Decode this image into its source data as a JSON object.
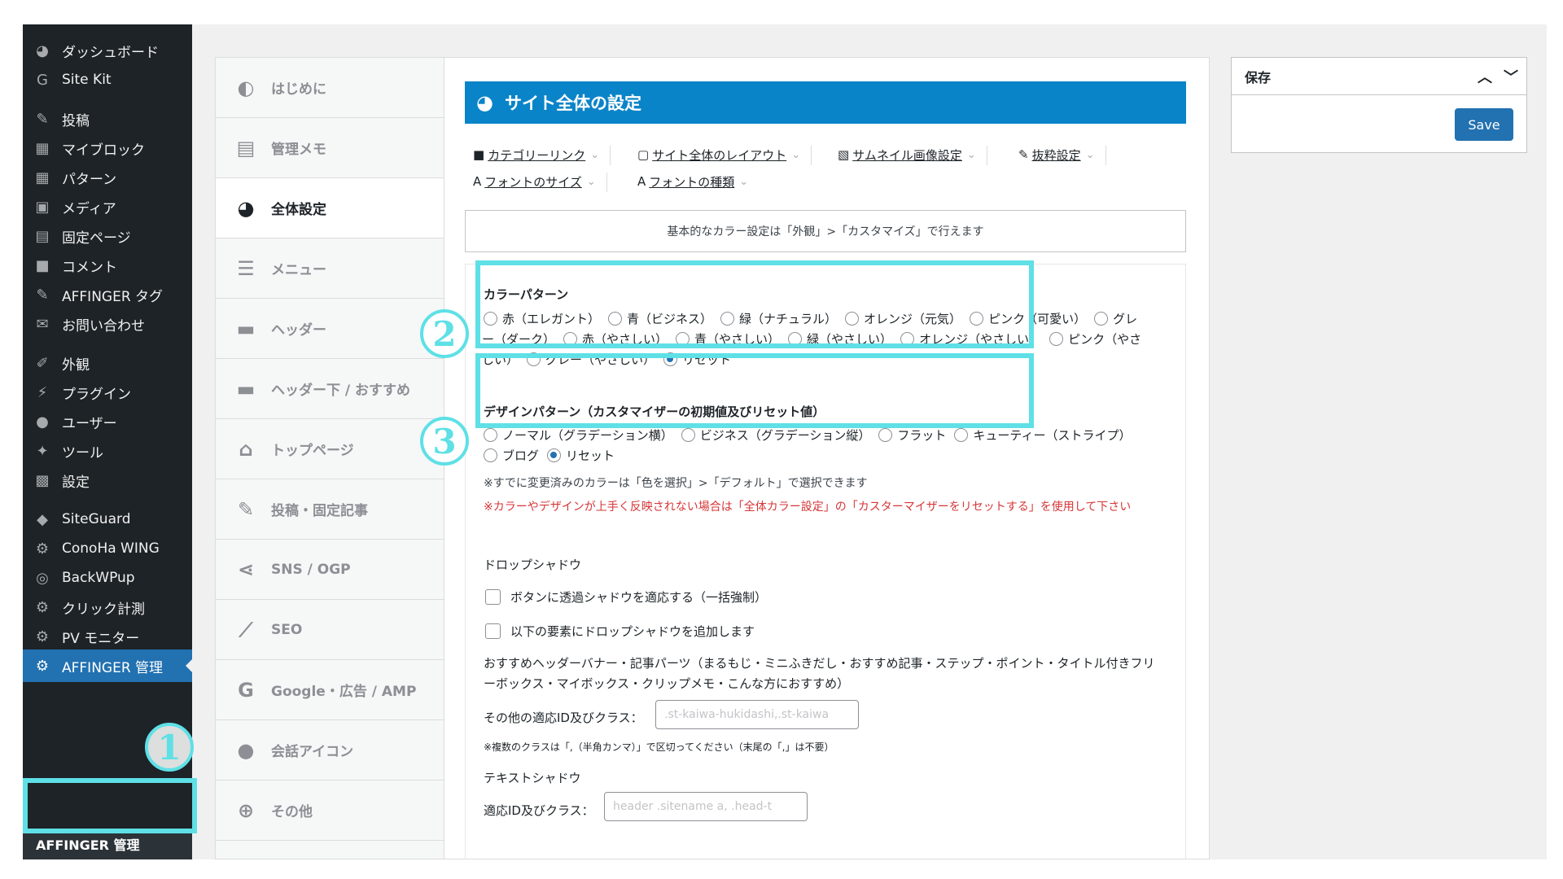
{
  "wp_menu": [
    {
      "label": "ダッシュボード",
      "icon": "dashboard-icon",
      "glyph": "◕"
    },
    {
      "label": "Site Kit",
      "icon": "google-g-icon",
      "glyph": "G"
    },
    {
      "label": "投稿",
      "icon": "pushpin-icon",
      "glyph": "✎"
    },
    {
      "label": "マイブロック",
      "icon": "blocks-grid-icon",
      "glyph": "▦"
    },
    {
      "label": "パターン",
      "icon": "pattern-grid-icon",
      "glyph": "▦"
    },
    {
      "label": "メディア",
      "icon": "media-icon",
      "glyph": "▣"
    },
    {
      "label": "固定ページ",
      "icon": "pages-icon",
      "glyph": "▤"
    },
    {
      "label": "コメント",
      "icon": "comment-icon",
      "glyph": "■"
    },
    {
      "label": "AFFINGER タグ",
      "icon": "pushpin-icon",
      "glyph": "✎"
    },
    {
      "label": "お問い合わせ",
      "icon": "mail-icon",
      "glyph": "✉"
    },
    {
      "label": "外観",
      "icon": "appearance-brush-icon",
      "glyph": "✐"
    },
    {
      "label": "プラグイン",
      "icon": "plugin-icon",
      "glyph": "⚡"
    },
    {
      "label": "ユーザー",
      "icon": "user-icon",
      "glyph": "●"
    },
    {
      "label": "ツール",
      "icon": "wrench-icon",
      "glyph": "✦"
    },
    {
      "label": "設定",
      "icon": "settings-icon",
      "glyph": "▩"
    },
    {
      "label": "SiteGuard",
      "icon": "siteguard-icon",
      "glyph": "◆"
    },
    {
      "label": "ConoHa WING",
      "icon": "gear-icon",
      "glyph": "⚙"
    },
    {
      "label": "BackWPup",
      "icon": "backwpup-icon",
      "glyph": "◎"
    },
    {
      "label": "クリック計測",
      "icon": "gear-icon",
      "glyph": "⚙"
    },
    {
      "label": "PV モニター",
      "icon": "gear-icon",
      "glyph": "⚙"
    },
    {
      "label": "AFFINGER 管理",
      "icon": "gear-icon",
      "glyph": "⚙"
    }
  ],
  "wp_submenu_label": "AFFINGER 管理",
  "badges": {
    "one": "1",
    "two": "2",
    "three": "3"
  },
  "highlight_color": "#5ee0e6",
  "aff_nav": [
    {
      "label": "はじめに",
      "icon": "beginner-leaf-icon",
      "glyph": "◐"
    },
    {
      "label": "管理メモ",
      "icon": "memo-document-icon",
      "glyph": "▤"
    },
    {
      "label": "全体設定",
      "icon": "palette-icon",
      "glyph": "◕"
    },
    {
      "label": "メニュー",
      "icon": "menu-bars-icon",
      "glyph": "☰"
    },
    {
      "label": "ヘッダー",
      "icon": "header-layout-icon",
      "glyph": "▬"
    },
    {
      "label": "ヘッダー下 / おすすめ",
      "icon": "header-below-icon",
      "glyph": "▬"
    },
    {
      "label": "トップページ",
      "icon": "home-icon",
      "glyph": "⌂"
    },
    {
      "label": "投稿・固定記事",
      "icon": "edit-post-icon",
      "glyph": "✎"
    },
    {
      "label": "SNS / OGP",
      "icon": "share-icon",
      "glyph": "⋖"
    },
    {
      "label": "SEO",
      "icon": "chart-line-icon",
      "glyph": "⟋"
    },
    {
      "label": "Google・広告 / AMP",
      "icon": "google-g-icon",
      "glyph": "G"
    },
    {
      "label": "会話アイコン",
      "icon": "speech-bubble-icon",
      "glyph": "●"
    },
    {
      "label": "その他",
      "icon": "plus-circle-icon",
      "glyph": "⊕"
    }
  ],
  "main": {
    "title": "サイト全体の設定",
    "title_icon": "palette-icon",
    "subnav": [
      {
        "label": "カテゴリーリンク",
        "icon": "folder-icon",
        "glyph": "■"
      },
      {
        "label": "サイト全体のレイアウト",
        "icon": "layout-icon",
        "glyph": "▢"
      },
      {
        "label": "サムネイル画像設定",
        "icon": "image-icon",
        "glyph": "▧"
      },
      {
        "label": "抜粋設定",
        "icon": "excerpt-icon",
        "glyph": "✎"
      },
      {
        "label": "フォントのサイズ",
        "icon": "font-a-icon",
        "glyph": "A"
      },
      {
        "label": "フォントの種類",
        "icon": "font-a-icon",
        "glyph": "A"
      }
    ],
    "notice": "基本的なカラー設定は「外観」>「カスタマイズ」で行えます",
    "color_pattern": {
      "label": "カラーパターン",
      "options": [
        "赤（エレガント）",
        "青（ビジネス）",
        "緑（ナチュラル）",
        "オレンジ（元気）",
        "ピンク（可愛い）",
        "グレー（ダーク）",
        "赤（やさしい）",
        "青（やさしい）",
        "緑（やさしい）",
        "オレンジ（やさしい）",
        "ピンク（やさしい）",
        "グレー（やさしい）",
        "リセット"
      ],
      "selected": "リセット"
    },
    "design_pattern": {
      "label": "デザインパターン（カスタマイザーの初期値及びリセット値）",
      "options": [
        "ノーマル（グラデーション横）",
        "ビジネス（グラデーション縦）",
        "フラット",
        "キューティー（ストライプ）",
        "ブログ",
        "リセット"
      ],
      "selected": "リセット"
    },
    "note_default": "※すでに変更済みのカラーは「色を選択」>「デフォルト」で選択できます",
    "note_warning": "※カラーやデザインが上手く反映されない場合は「全体カラー設定」の「カスターマイザーをリセットする」を使用して下さい",
    "drop_shadow": {
      "heading": "ドロップシャドウ",
      "check1": "ボタンに透過シャドウを適応する（一括強制）",
      "check2": "以下の要素にドロップシャドウを追加します",
      "desc": "おすすめヘッダーバナー・記事パーツ（まるもじ・ミニふきだし・おすすめ記事・ステップ・ポイント・タイトル付きフリーボックス・マイボックス・クリップメモ・こんな方におすすめ）",
      "input_label": "その他の適応ID及びクラス：",
      "input_placeholder": ".st-kaiwa-hukidashi,.st-kaiwa",
      "hint": "※複数のクラスは「,（半角カンマ）」で区切ってください（末尾の「,」は不要）"
    },
    "text_shadow": {
      "heading": "テキストシャドウ",
      "input_label": "適応ID及びクラス：",
      "input_placeholder": "header .sitename a, .head-t"
    }
  },
  "save_box": {
    "title": "保存",
    "button": "Save",
    "arrow_up": "︿",
    "arrow_down": "﹀"
  }
}
